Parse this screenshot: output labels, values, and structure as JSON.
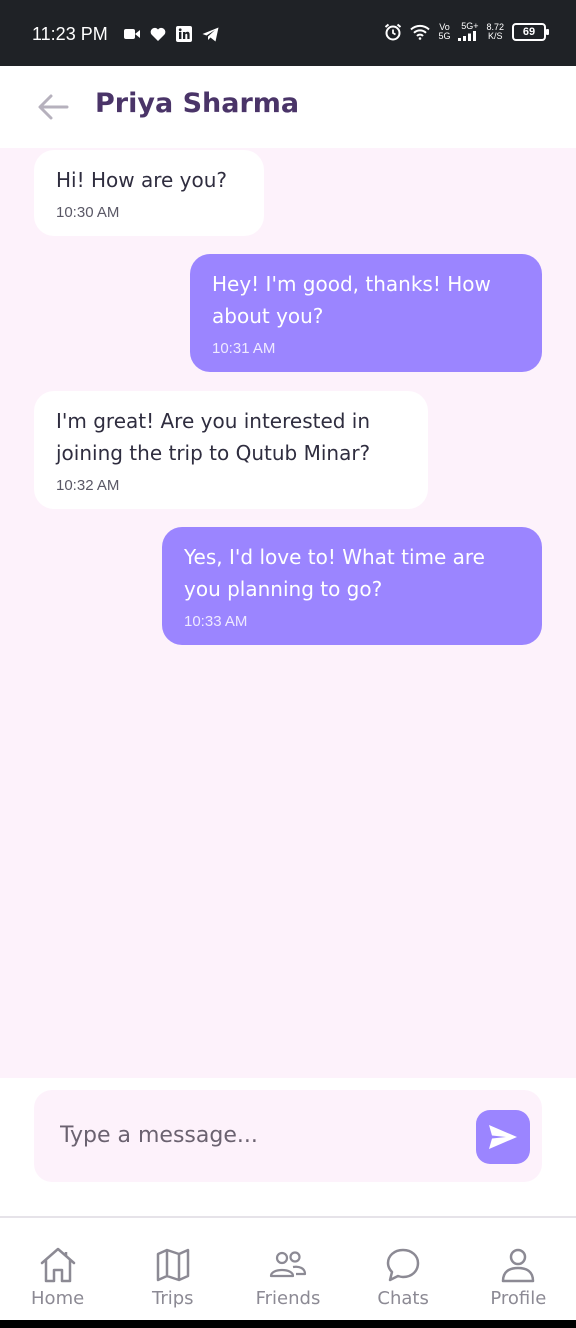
{
  "status_bar": {
    "time": "11:23 PM",
    "network_top": "Vo",
    "network_bottom": "5G",
    "signal_label": "5G+",
    "speed_top": "8.72",
    "speed_bottom": "K/S",
    "battery": "69"
  },
  "header": {
    "contact_name": "Priya Sharma"
  },
  "messages": [
    {
      "direction": "incoming",
      "text": "Hi! How are you?",
      "time": "10:30 AM"
    },
    {
      "direction": "outgoing",
      "text": "Hey! I'm good, thanks! How about you?",
      "time": "10:31 AM"
    },
    {
      "direction": "incoming",
      "text": "I'm great! Are you interested in joining the trip to Qutub Minar?",
      "time": "10:32 AM"
    },
    {
      "direction": "outgoing",
      "text": "Yes, I'd love to! What time are you planning to go?",
      "time": "10:33 AM"
    }
  ],
  "composer": {
    "placeholder": "Type a message...",
    "value": ""
  },
  "nav": {
    "items": [
      {
        "label": "Home",
        "icon": "home-icon"
      },
      {
        "label": "Trips",
        "icon": "map-icon"
      },
      {
        "label": "Friends",
        "icon": "friends-icon"
      },
      {
        "label": "Chats",
        "icon": "chat-icon"
      },
      {
        "label": "Profile",
        "icon": "profile-icon"
      }
    ]
  },
  "colors": {
    "accent": "#9b85ff",
    "background": "#fdf2fb",
    "title": "#4a3468"
  }
}
